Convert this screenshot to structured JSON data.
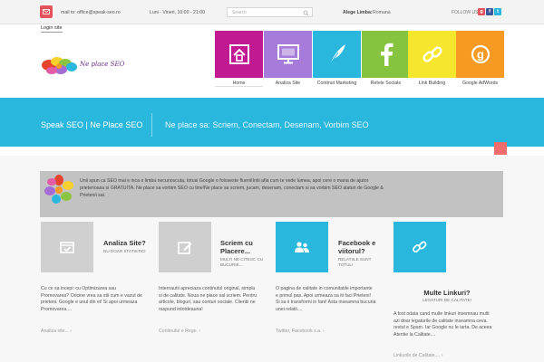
{
  "topbar": {
    "email": "mail to: office@speak-seo.ro",
    "hours": "Luni - Vineri, 10:00 - 21:00",
    "search_placeholder": "Search",
    "language_label": "Alege Limba:",
    "language_value": "Romana",
    "follow_label": "FOLLOW US",
    "social": [
      {
        "icon": "google-plus-icon",
        "glyph": "g",
        "color": "#e4525b"
      },
      {
        "icon": "facebook-icon",
        "glyph": "f",
        "color": "#3b5998"
      },
      {
        "icon": "twitter-icon",
        "glyph": "t",
        "color": "#2ab7de"
      }
    ]
  },
  "login_label": "Login site",
  "logo_text": "Ne place SEO",
  "nav": [
    {
      "label": "Home",
      "color": "#c1198f",
      "icon": "home-icon"
    },
    {
      "label": "Analiza Site",
      "color": "#a77bda",
      "icon": "monitor-icon"
    },
    {
      "label": "Continut Marketing",
      "color": "#2ab7de",
      "icon": "feather-icon"
    },
    {
      "label": "Retele Sociale",
      "color": "#86c440",
      "icon": "facebook-icon"
    },
    {
      "label": "Link Building",
      "color": "#f6e72e",
      "icon": "link-icon"
    },
    {
      "label": "Google AdWords",
      "color": "#f69a24",
      "icon": "google-icon"
    }
  ],
  "band": {
    "title": "Speak SEO | Ne Place SEO",
    "subtitle": "Ne place sa: Scriem, Conectam, Desenam, Vorbim SEO"
  },
  "intro_line1": "Unii spun ca SEO mai e inca o limba necunoscuta, totusi Google o foloseste fluent!Intii afla cum te vede lumea, apoi cere o mana de ajutor",
  "intro_line2": "prietenoasa si GRATUITA. Ne place sa vorbim SEO cu tine!Ne place sa scriem, jucam, desenam, conectam si sa vorbim SEO alaturi de Google &",
  "intro_line3": "Prietenii sai.",
  "cards": [
    {
      "title_line1": "Analiza Site?",
      "title_line2": "",
      "sub_line1": "NU DOAR STATISTICI",
      "sub_line2": "",
      "body_line1": "Cu ce sa incepi: cu Optimizarea sau",
      "body_line2": "Promovarea? Oricine vrea sa stii cum e vazut de",
      "body_line3": "prieteni. Google e unul din ei! Si apoi urmeaza",
      "body_line4": "Promovarea....",
      "link": "Analiza site...",
      "color": "#d0d0d0",
      "icon": "checklist-icon"
    },
    {
      "title_line1": "Scriem cu",
      "title_line2": "Placere...",
      "sub_line1": "MULTI NE CITESC CU",
      "sub_line2": "BUCURIE....",
      "body_line1": "Internautii apreciaza continutul original, simplu",
      "body_line2": "si de calitate. Noua ne place sal scriem. Pentru",
      "body_line3": "articole, bloguri, sau conturi sociale. Clientii ne",
      "body_line4": "raspund intotdeauna!",
      "link": "Continutul e Rege.",
      "color": "#cfcfcf",
      "icon": "edit-icon"
    },
    {
      "title_line1": "Facebook e",
      "title_line2": "viitorul?",
      "sub_line1": "RELATIILE SUNT",
      "sub_line2": "TOTUL!",
      "body_line1": "O pagina de calitate in comunitatile importante",
      "body_line2": "e primul pas. Apoi urmeaza sa iti faci Prieteni!",
      "body_line3": "Si sa ii transformi in fani! Asta inseamna bucuria",
      "body_line4": "unei relatii....",
      "link": "Twitter, Facebook s.a.",
      "color": "#2ab7de",
      "icon": "users-icon"
    },
    {
      "title_line1": "Multe Linkuri?",
      "title_line2": "",
      "sub_line1": "LEGATURI DE CALITATE!",
      "sub_line2": "",
      "body_line1": "A fost odata cand multe linkuri insemnau multi",
      "body_line2": "azi doar legaturile de calitate inseamna ceva.",
      "body_line3": "restul e Spam. Iar Google nu le iarta. De aceea",
      "body_line4": "Atentie la Calitate....",
      "link": "Linkurile de Calitate....",
      "color": "#2ab7de",
      "icon": "link-icon"
    }
  ]
}
